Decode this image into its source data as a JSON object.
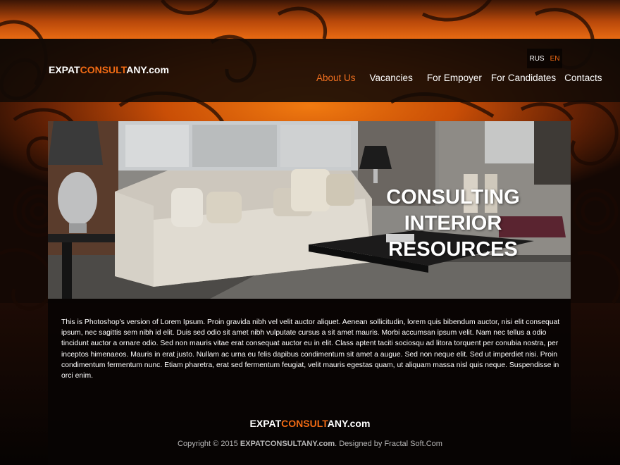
{
  "header": {
    "logo": {
      "part1": "EXPAT",
      "part2": "CONSULT",
      "part3": "ANY.com"
    },
    "languages": [
      {
        "label": "RUS",
        "active": false
      },
      {
        "label": "EN",
        "active": true
      }
    ],
    "nav": [
      {
        "label": "About Us",
        "active": true
      },
      {
        "label": "Vacancies",
        "active": false
      },
      {
        "label": "For Empoyer",
        "active": false
      },
      {
        "label": "For Candidates",
        "active": false
      },
      {
        "label": "Contacts",
        "active": false
      }
    ]
  },
  "hero": {
    "title_line1": "CONSULTING INTERIOR",
    "title_line2": "RESOURCES"
  },
  "content": {
    "body": "This is Photoshop's version  of Lorem Ipsum. Proin gravida nibh vel velit auctor aliquet. Aenean sollicitudin, lorem quis bibendum auctor, nisi elit consequat ipsum, nec sagittis sem nibh id elit. Duis sed odio sit amet nibh vulputate cursus a sit amet mauris. Morbi accumsan ipsum velit. Nam nec tellus a odio tincidunt auctor a ornare odio. Sed non  mauris vitae erat consequat auctor eu in elit. Class aptent taciti sociosqu ad litora torquent per conubia nostra, per inceptos himenaeos. Mauris in erat justo. Nullam ac urna eu felis dapibus condimentum sit amet a augue. Sed non neque elit. Sed ut imperdiet nisi. Proin condimentum fermentum nunc. Etiam pharetra, erat sed fermentum feugiat, velit mauris egestas quam, ut aliquam massa nisl quis neque. Suspendisse in orci enim."
  },
  "footer": {
    "logo": {
      "part1": "EXPAT",
      "part2": "CONSULT",
      "part3": "ANY.com"
    },
    "copyright_prefix": "Copyright © 2015",
    "copyright_site": "EXPATCONSULTANY.com",
    "copyright_suffix": ". Designed by Fractal Soft.Com"
  },
  "colors": {
    "accent": "#f06a14",
    "background": "#0b0503",
    "orange_glow": "#f07a10"
  }
}
